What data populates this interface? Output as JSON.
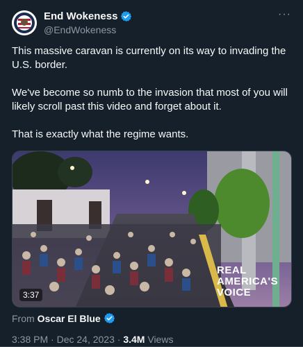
{
  "author": {
    "display_name": "End Wokeness",
    "handle": "@EndWokeness",
    "verified": true
  },
  "tweet": {
    "paragraphs": [
      "This massive caravan is currently on its way to invading the U.S. border.",
      "We've become so numb to the invasion that most of you will likely scroll past this video and forget about it.",
      "That is exactly what the regime wants."
    ]
  },
  "video": {
    "duration": "3:37",
    "watermark_line1": "REAL",
    "watermark_line2": "AMERICA'S",
    "watermark_line3": "VOICE"
  },
  "source": {
    "prefix": "From",
    "name": "Oscar El Blue",
    "verified": true
  },
  "meta": {
    "time": "3:38 PM",
    "separator": "·",
    "date": "Dec 24, 2023",
    "views_count": "3.4M",
    "views_label": "Views"
  },
  "colors": {
    "background": "#15202b",
    "text_primary": "#f7f9f9",
    "text_secondary": "#8b98a5",
    "verified_blue": "#1d9bf0"
  }
}
